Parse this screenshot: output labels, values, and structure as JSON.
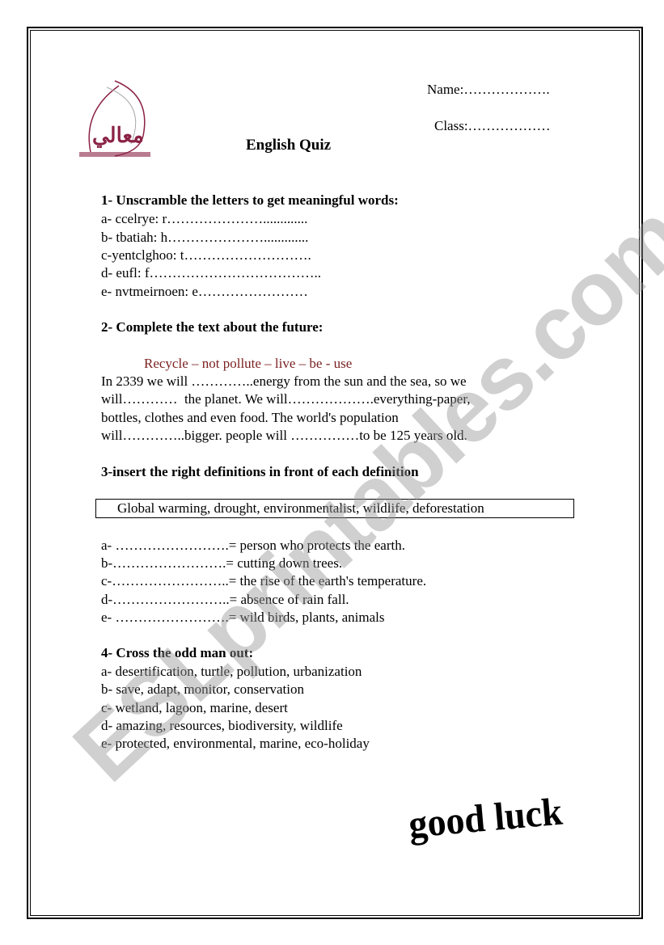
{
  "header": {
    "name_label": "Name:……………….",
    "class_label": "Class:………………",
    "title": "English Quiz",
    "logo_text": "معالي"
  },
  "section1": {
    "heading": "1- Unscramble the letters to get meaningful words:",
    "items": [
      "a- ccelrye: r………………….............",
      "b- tbatiah: h………………….............",
      "c-yentclghoo: t……………………….",
      "d- eufl: f………………………………..",
      "e- nvtmeirnoen: e……………………"
    ]
  },
  "section2": {
    "heading": "2- Complete the text about the future:",
    "word_bank": "Recycle – not pollute – live – be - use",
    "lines": [
      "In 2339 we will …………..energy from the sun and the sea, so we",
      "will…………  the planet. We will……………….everything-paper,",
      "bottles, clothes and even food. The world's population",
      "will…………..bigger. people will ……………to be 125 years old."
    ]
  },
  "section3": {
    "heading": "3-insert the right definitions in front of each definition",
    "word_box": "Global warming, drought, environmentalist, wildlife, deforestation",
    "items": [
      "a- …………………….= person who protects the earth.",
      "b-…………………….= cutting down trees.",
      "c-……………………..= the rise of the earth's temperature.",
      "d-……………………..= absence of rain fall.",
      "e- …………………….= wild birds, plants, animals"
    ]
  },
  "section4": {
    "heading": "4- Cross the odd man out:",
    "items": [
      "a- desertification, turtle, pollution, urbanization",
      "b- save, adapt, monitor, conservation",
      "c- wetland, lagoon, marine, desert",
      "d- amazing, resources, biodiversity, wildlife",
      "e- protected, environmental, marine, eco-holiday"
    ]
  },
  "footer": {
    "good_luck": "good luck"
  },
  "watermark": "ESLprintables.com",
  "colors": {
    "word_bank": "#7a1f1f",
    "logo": "#8b2346"
  }
}
